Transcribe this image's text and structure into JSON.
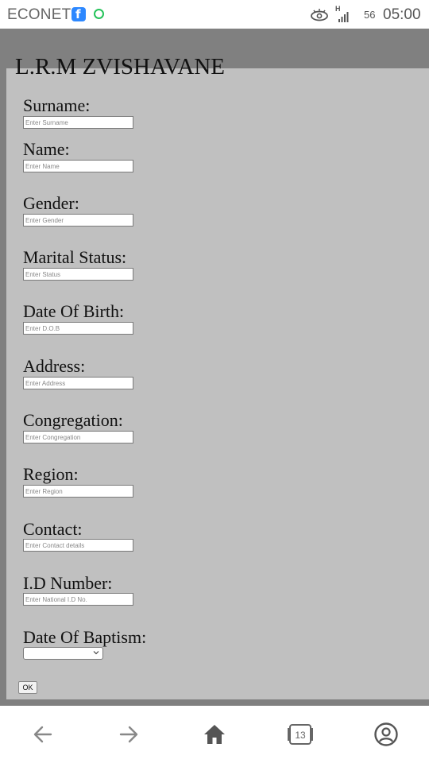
{
  "status_bar": {
    "carrier": "ECONET",
    "network_label": "56",
    "time": "05:00",
    "signal_type": "H"
  },
  "page": {
    "title": "L.R.M ZVISHAVANE",
    "fields": [
      {
        "label": "Surname:",
        "placeholder": "Enter Surname"
      },
      {
        "label": "Name:",
        "placeholder": "Enter Name"
      },
      {
        "label": "Gender:",
        "placeholder": "Enter Gender"
      },
      {
        "label": "Marital Status:",
        "placeholder": "Enter Status"
      },
      {
        "label": "Date Of Birth:",
        "placeholder": "Enter D.O.B"
      },
      {
        "label": "Address:",
        "placeholder": "Enter Address"
      },
      {
        "label": "Congregation:",
        "placeholder": "Enter Congregation"
      },
      {
        "label": "Region:",
        "placeholder": "Enter Region"
      },
      {
        "label": "Contact:",
        "placeholder": "Enter Contact details"
      },
      {
        "label": "I.D Number:",
        "placeholder": "Enter National I.D No."
      }
    ],
    "baptism": {
      "label": "Date Of Baptism:",
      "selected": ""
    },
    "submit_label": "OK"
  },
  "nav": {
    "tab_count": "13",
    "icons": [
      "back-arrow-icon",
      "forward-arrow-icon",
      "home-icon",
      "tabs-icon",
      "profile-icon"
    ]
  },
  "colors": {
    "page_background": "#c0c0c0",
    "outer_background": "#808080"
  }
}
